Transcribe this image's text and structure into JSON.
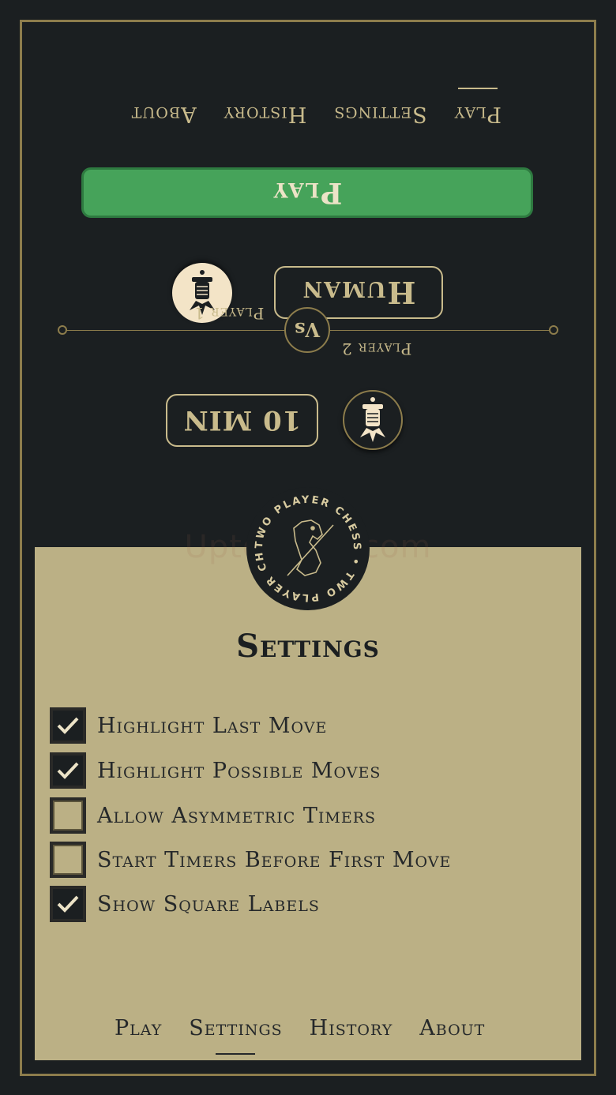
{
  "nav": {
    "items": [
      "Play",
      "Settings",
      "History",
      "About"
    ],
    "active": "Settings"
  },
  "player1": {
    "nav_items": [
      "Play",
      "Settings",
      "History",
      "About"
    ],
    "active": "Play",
    "play_label": "Play",
    "opponent_label": "Human",
    "player_label": "Player 1"
  },
  "player2": {
    "player_label": "Player 2",
    "time_label": "10 MIN"
  },
  "vs_label": "Vs",
  "logo_text": "TWO PLAYER CHESS",
  "watermark": "Uptodown.com",
  "settings": {
    "title": "Settings",
    "options": [
      {
        "label": "Highlight Last Move",
        "checked": true
      },
      {
        "label": "Highlight Possible Moves",
        "checked": true
      },
      {
        "label": "Allow Asymmetric Timers",
        "checked": false
      },
      {
        "label": "Start Timers Before First Move",
        "checked": false
      },
      {
        "label": "Show Square Labels",
        "checked": true
      }
    ]
  },
  "colors": {
    "background": "#1b1f21",
    "gold": "#c9bb8c",
    "panel": "#bbb085",
    "play_green": "#46a35a"
  }
}
